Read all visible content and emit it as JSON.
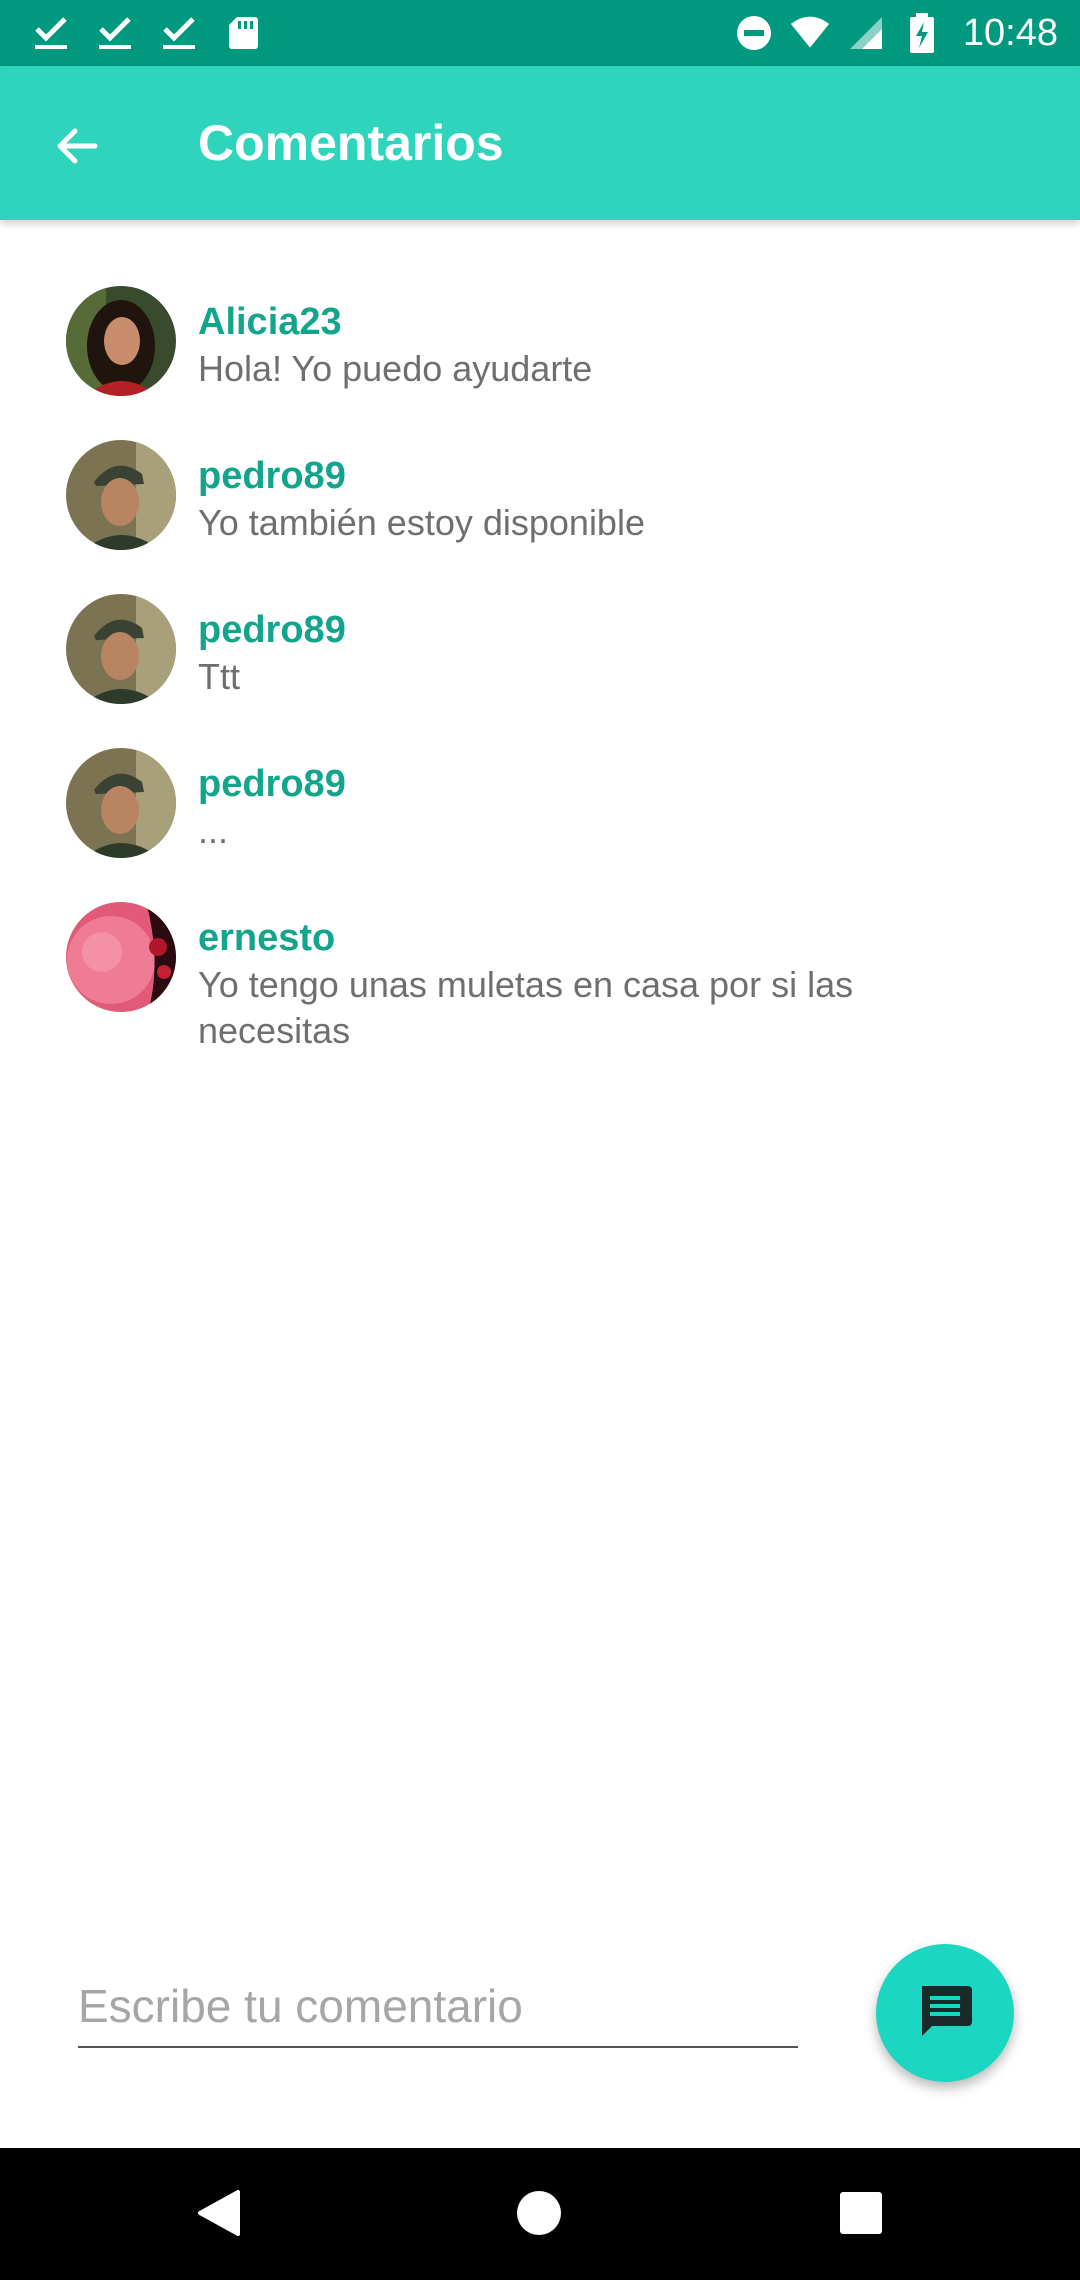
{
  "status_bar": {
    "time": "10:48",
    "left_icons": [
      "check-icon",
      "check-icon",
      "check-icon",
      "sd-card-icon"
    ],
    "right_icons": [
      "do-not-disturb-icon",
      "wifi-icon",
      "signal-icon",
      "battery-charging-icon"
    ]
  },
  "appbar": {
    "title": "Comentarios",
    "back_icon": "arrow-back-icon",
    "color": "#2fd4bd"
  },
  "comments": [
    {
      "user": "Alicia23",
      "text": "Hola! Yo puedo ayudarte",
      "avatar": "avatar-woman"
    },
    {
      "user": "pedro89",
      "text": "Yo también estoy disponible",
      "avatar": "avatar-man-cap"
    },
    {
      "user": "pedro89",
      "text": "Ttt",
      "avatar": "avatar-man-cap"
    },
    {
      "user": "pedro89",
      "text": "...",
      "avatar": "avatar-man-cap"
    },
    {
      "user": "ernesto",
      "text": "Yo tengo unas muletas en casa por si las necesitas",
      "avatar": "avatar-pink"
    }
  ],
  "input": {
    "value": "",
    "placeholder": "Escribe tu comentario"
  },
  "fab": {
    "icon": "comment-icon",
    "color": "#1bd6c1"
  },
  "nav": {
    "icons": [
      "back-triangle-icon",
      "home-circle-icon",
      "recents-square-icon"
    ]
  }
}
